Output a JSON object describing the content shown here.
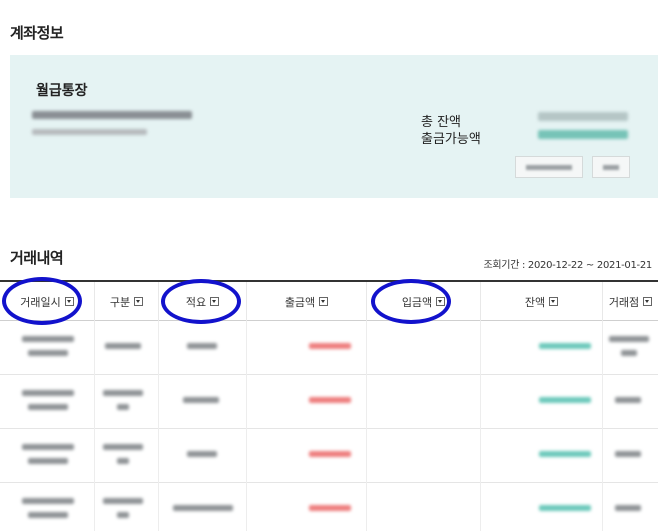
{
  "account_section": {
    "title": "계좌정보",
    "account_name": "월급통장",
    "total_balance_label": "총 잔액",
    "available_label": "출금가능액"
  },
  "transactions": {
    "title": "거래내역",
    "period": "조회기간 : 2020-12-22 ~ 2021-01-21",
    "columns": [
      "거래일시",
      "구분",
      "적요",
      "출금액",
      "입금액",
      "잔액",
      "거래점"
    ],
    "highlighted_columns": [
      "거래일시",
      "적요",
      "입금액"
    ]
  },
  "colors": {
    "account_bg": "#e5f3f3",
    "withdrawal": "#ee7e7e",
    "balance": "#6cc9bb",
    "highlight_circle": "#1212cc"
  }
}
